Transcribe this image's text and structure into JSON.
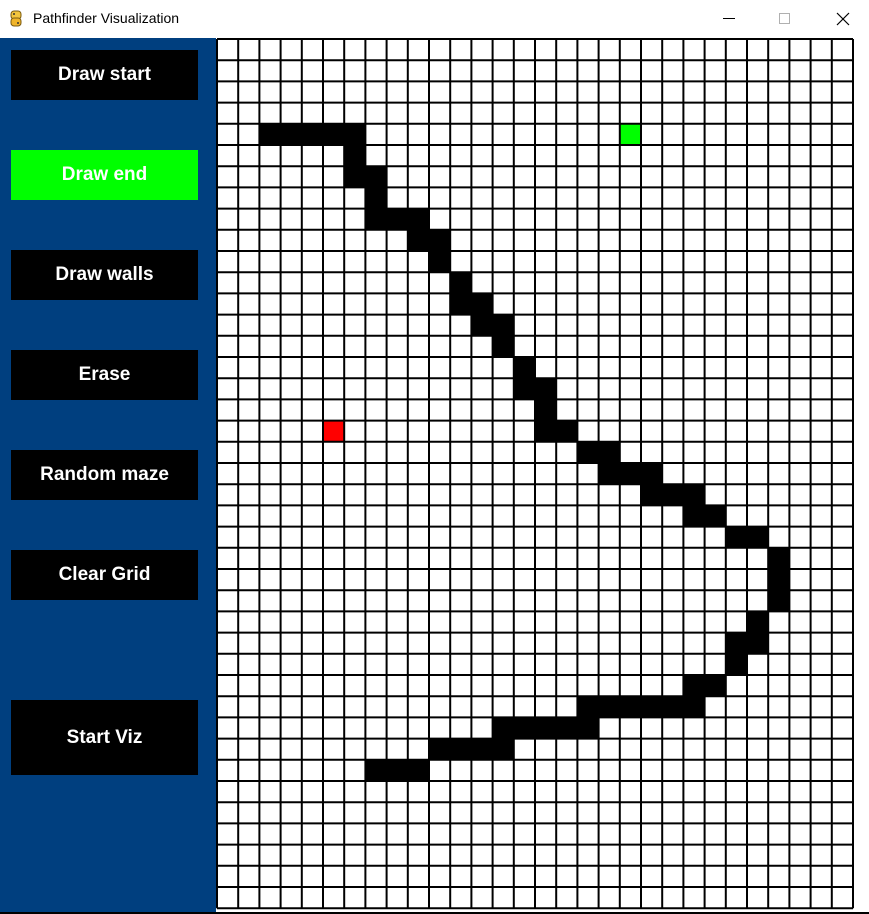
{
  "window": {
    "title": "Pathfinder Visualization",
    "icon": "python-icon",
    "controls": [
      "minimize-icon",
      "maximize-icon",
      "close-icon"
    ]
  },
  "sidebar": {
    "background_color": "#003f7f",
    "buttons": [
      {
        "id": "draw-start-button",
        "label": "Draw start",
        "color": "#000000",
        "active": false
      },
      {
        "id": "draw-end-button",
        "label": "Draw end",
        "color": "#00ff00",
        "active": true
      },
      {
        "id": "draw-walls-button",
        "label": "Draw walls",
        "color": "#000000",
        "active": false
      },
      {
        "id": "erase-button",
        "label": "Erase",
        "color": "#000000",
        "active": false
      },
      {
        "id": "random-maze-button",
        "label": "Random maze",
        "color": "#000000",
        "active": false
      },
      {
        "id": "clear-grid-button",
        "label": "Clear Grid",
        "color": "#000000",
        "active": false
      },
      {
        "id": "start-viz-button",
        "label": "Start Viz",
        "color": "#000000",
        "active": false
      }
    ]
  },
  "grid": {
    "columns": 30,
    "rows": 41,
    "line_color": "#000000",
    "empty_color": "#ffffff",
    "wall_color": "#000000",
    "start_color": "#ff0000",
    "end_color": "#00ff00",
    "start": {
      "col": 5,
      "row": 18
    },
    "end": {
      "col": 19,
      "row": 4
    },
    "walls": [
      [
        2,
        4
      ],
      [
        3,
        4
      ],
      [
        4,
        4
      ],
      [
        5,
        4
      ],
      [
        6,
        4
      ],
      [
        6,
        5
      ],
      [
        6,
        6
      ],
      [
        7,
        6
      ],
      [
        7,
        7
      ],
      [
        7,
        8
      ],
      [
        8,
        8
      ],
      [
        9,
        8
      ],
      [
        9,
        9
      ],
      [
        10,
        9
      ],
      [
        10,
        10
      ],
      [
        11,
        11
      ],
      [
        11,
        12
      ],
      [
        12,
        12
      ],
      [
        12,
        13
      ],
      [
        13,
        13
      ],
      [
        13,
        14
      ],
      [
        14,
        15
      ],
      [
        14,
        16
      ],
      [
        15,
        16
      ],
      [
        15,
        17
      ],
      [
        15,
        18
      ],
      [
        16,
        18
      ],
      [
        17,
        19
      ],
      [
        18,
        19
      ],
      [
        18,
        20
      ],
      [
        19,
        20
      ],
      [
        20,
        20
      ],
      [
        20,
        21
      ],
      [
        21,
        21
      ],
      [
        22,
        21
      ],
      [
        22,
        22
      ],
      [
        23,
        22
      ],
      [
        24,
        23
      ],
      [
        25,
        23
      ],
      [
        26,
        24
      ],
      [
        26,
        25
      ],
      [
        26,
        26
      ],
      [
        25,
        27
      ],
      [
        25,
        28
      ],
      [
        24,
        28
      ],
      [
        24,
        29
      ],
      [
        23,
        30
      ],
      [
        22,
        30
      ],
      [
        22,
        31
      ],
      [
        21,
        31
      ],
      [
        20,
        31
      ],
      [
        19,
        31
      ],
      [
        18,
        31
      ],
      [
        17,
        31
      ],
      [
        17,
        32
      ],
      [
        16,
        32
      ],
      [
        15,
        32
      ],
      [
        14,
        32
      ],
      [
        13,
        32
      ],
      [
        13,
        33
      ],
      [
        12,
        33
      ],
      [
        11,
        33
      ],
      [
        10,
        33
      ],
      [
        9,
        34
      ],
      [
        8,
        34
      ],
      [
        7,
        34
      ]
    ]
  }
}
